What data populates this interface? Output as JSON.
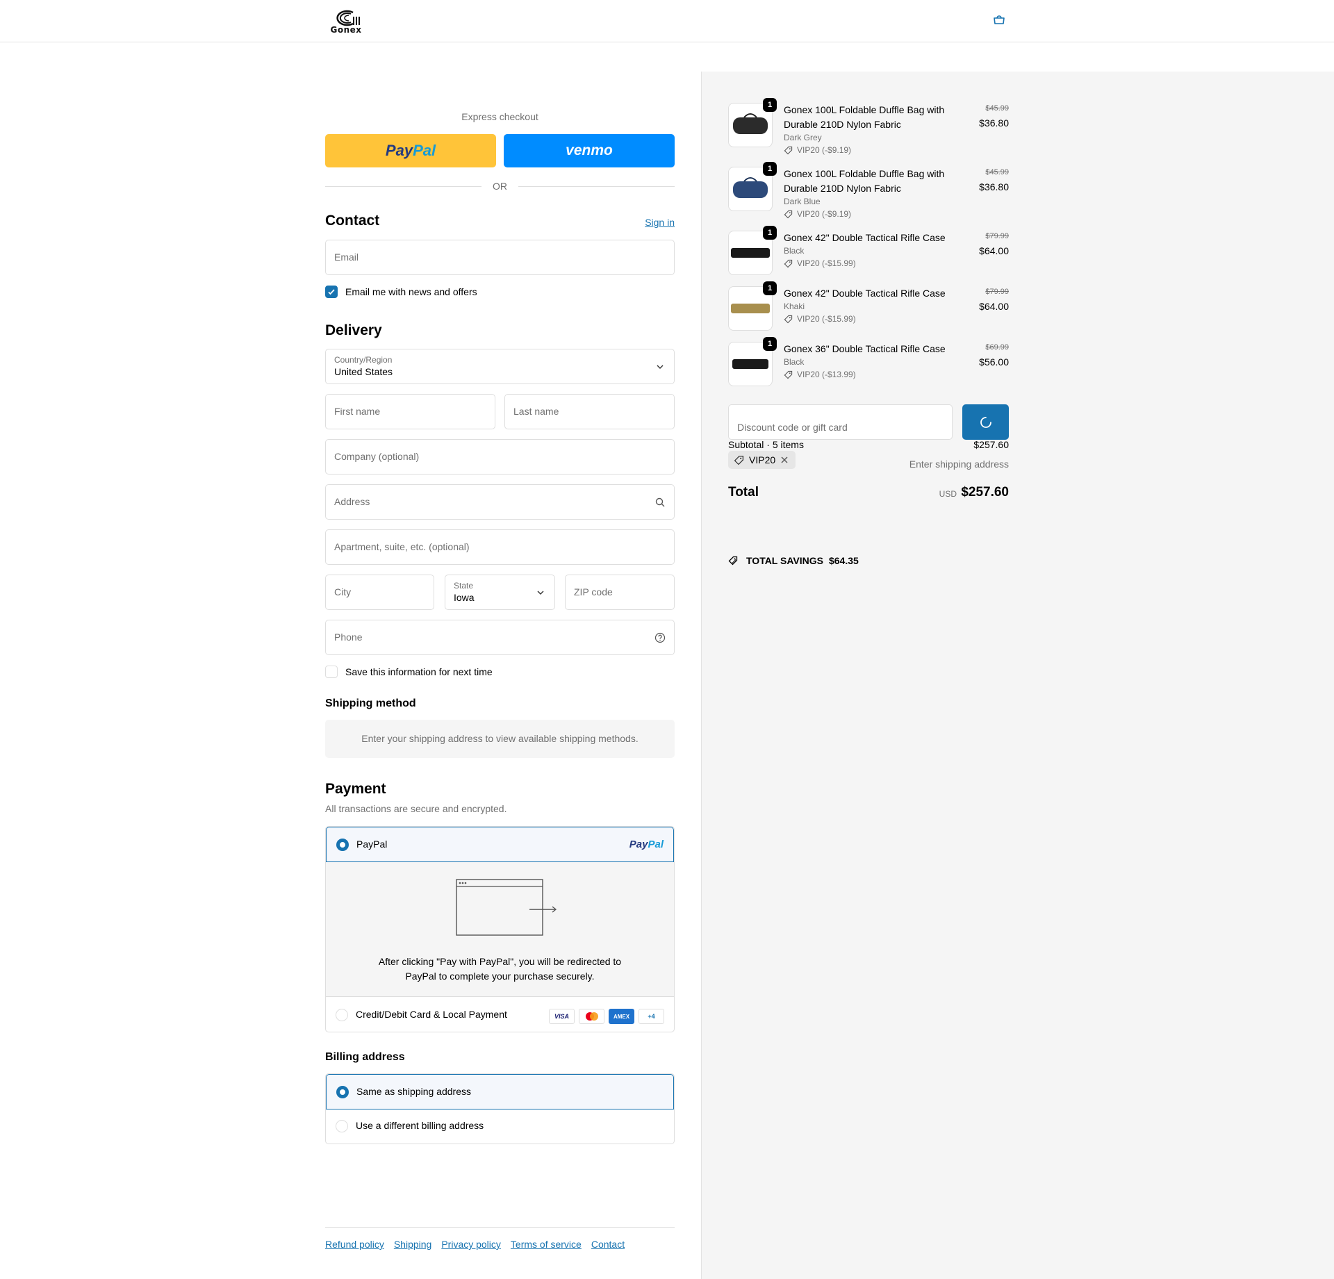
{
  "header": {
    "logo_text": "Gonex",
    "cart_icon": "bag-icon"
  },
  "express": {
    "title": "Express checkout",
    "paypal_label_1": "Pay",
    "paypal_label_2": "Pal",
    "venmo_label": "venmo",
    "or_label": "OR"
  },
  "contact": {
    "title": "Contact",
    "sign_in": "Sign in",
    "email_placeholder": "Email",
    "newsletter_label": "Email me with news and offers",
    "newsletter_checked": true
  },
  "delivery": {
    "title": "Delivery",
    "country_label": "Country/Region",
    "country_value": "United States",
    "first_name_placeholder": "First name",
    "last_name_placeholder": "Last name",
    "company_placeholder": "Company (optional)",
    "address_placeholder": "Address",
    "apartment_placeholder": "Apartment, suite, etc. (optional)",
    "city_placeholder": "City",
    "state_label": "State",
    "state_value": "Iowa",
    "zip_placeholder": "ZIP code",
    "phone_placeholder": "Phone",
    "save_info_label": "Save this information for next time"
  },
  "shipping": {
    "title": "Shipping method",
    "message": "Enter your shipping address to view available shipping methods."
  },
  "payment": {
    "title": "Payment",
    "subtitle": "All transactions are secure and encrypted.",
    "paypal_option": "PayPal",
    "paypal_logo_1": "Pay",
    "paypal_logo_2": "Pal",
    "redirect_text": "After clicking \"Pay with PayPal\", you will be redirected to PayPal to complete your purchase securely.",
    "card_option": "Credit/Debit Card & Local Payment",
    "card_icons": [
      "VISA",
      "mastercard",
      "AMEX",
      "+4"
    ]
  },
  "billing": {
    "title": "Billing address",
    "same_option": "Same as shipping address",
    "different_option": "Use a different billing address"
  },
  "footer": {
    "links": [
      "Refund policy",
      "Shipping",
      "Privacy policy",
      "Terms of service",
      "Contact"
    ]
  },
  "order": {
    "items": [
      {
        "qty": "1",
        "name": "Gonex 100L Foldable Duffle Bag with Durable 210D Nylon Fabric",
        "variant": "Dark Grey",
        "discount": "VIP20 (-$9.19)",
        "original": "$45.99",
        "price": "$36.80",
        "color": "#2b2b2b"
      },
      {
        "qty": "1",
        "name": "Gonex 100L Foldable Duffle Bag with Durable 210D Nylon Fabric",
        "variant": "Dark Blue",
        "discount": "VIP20 (-$9.19)",
        "original": "$45.99",
        "price": "$36.80",
        "color": "#2d4a7a"
      },
      {
        "qty": "1",
        "name": "Gonex 42\" Double Tactical Rifle Case",
        "variant": "Black",
        "discount": "VIP20 (-$15.99)",
        "original": "$79.99",
        "price": "$64.00",
        "color": "#1a1a1a"
      },
      {
        "qty": "1",
        "name": "Gonex 42\" Double Tactical Rifle Case",
        "variant": "Khaki",
        "discount": "VIP20 (-$15.99)",
        "original": "$79.99",
        "price": "$64.00",
        "color": "#a88f4e"
      },
      {
        "qty": "1",
        "name": "Gonex 36\" Double Tactical Rifle Case",
        "variant": "Black",
        "discount": "VIP20 (-$13.99)",
        "original": "$69.99",
        "price": "$56.00",
        "color": "#1a1a1a"
      }
    ],
    "discount_placeholder": "Discount code or gift card",
    "subtotal_label": "Subtotal · 5 items",
    "subtotal_value": "$257.60",
    "applied_code": "VIP20",
    "shipping_note": "Enter shipping address",
    "total_label": "Total",
    "currency": "USD",
    "total_value": "$257.60",
    "savings_label": "TOTAL SAVINGS",
    "savings_value": "$64.35"
  },
  "colors": {
    "accent": "#1773b0",
    "paypal_yellow": "#ffc439",
    "venmo_blue": "#008cff"
  }
}
